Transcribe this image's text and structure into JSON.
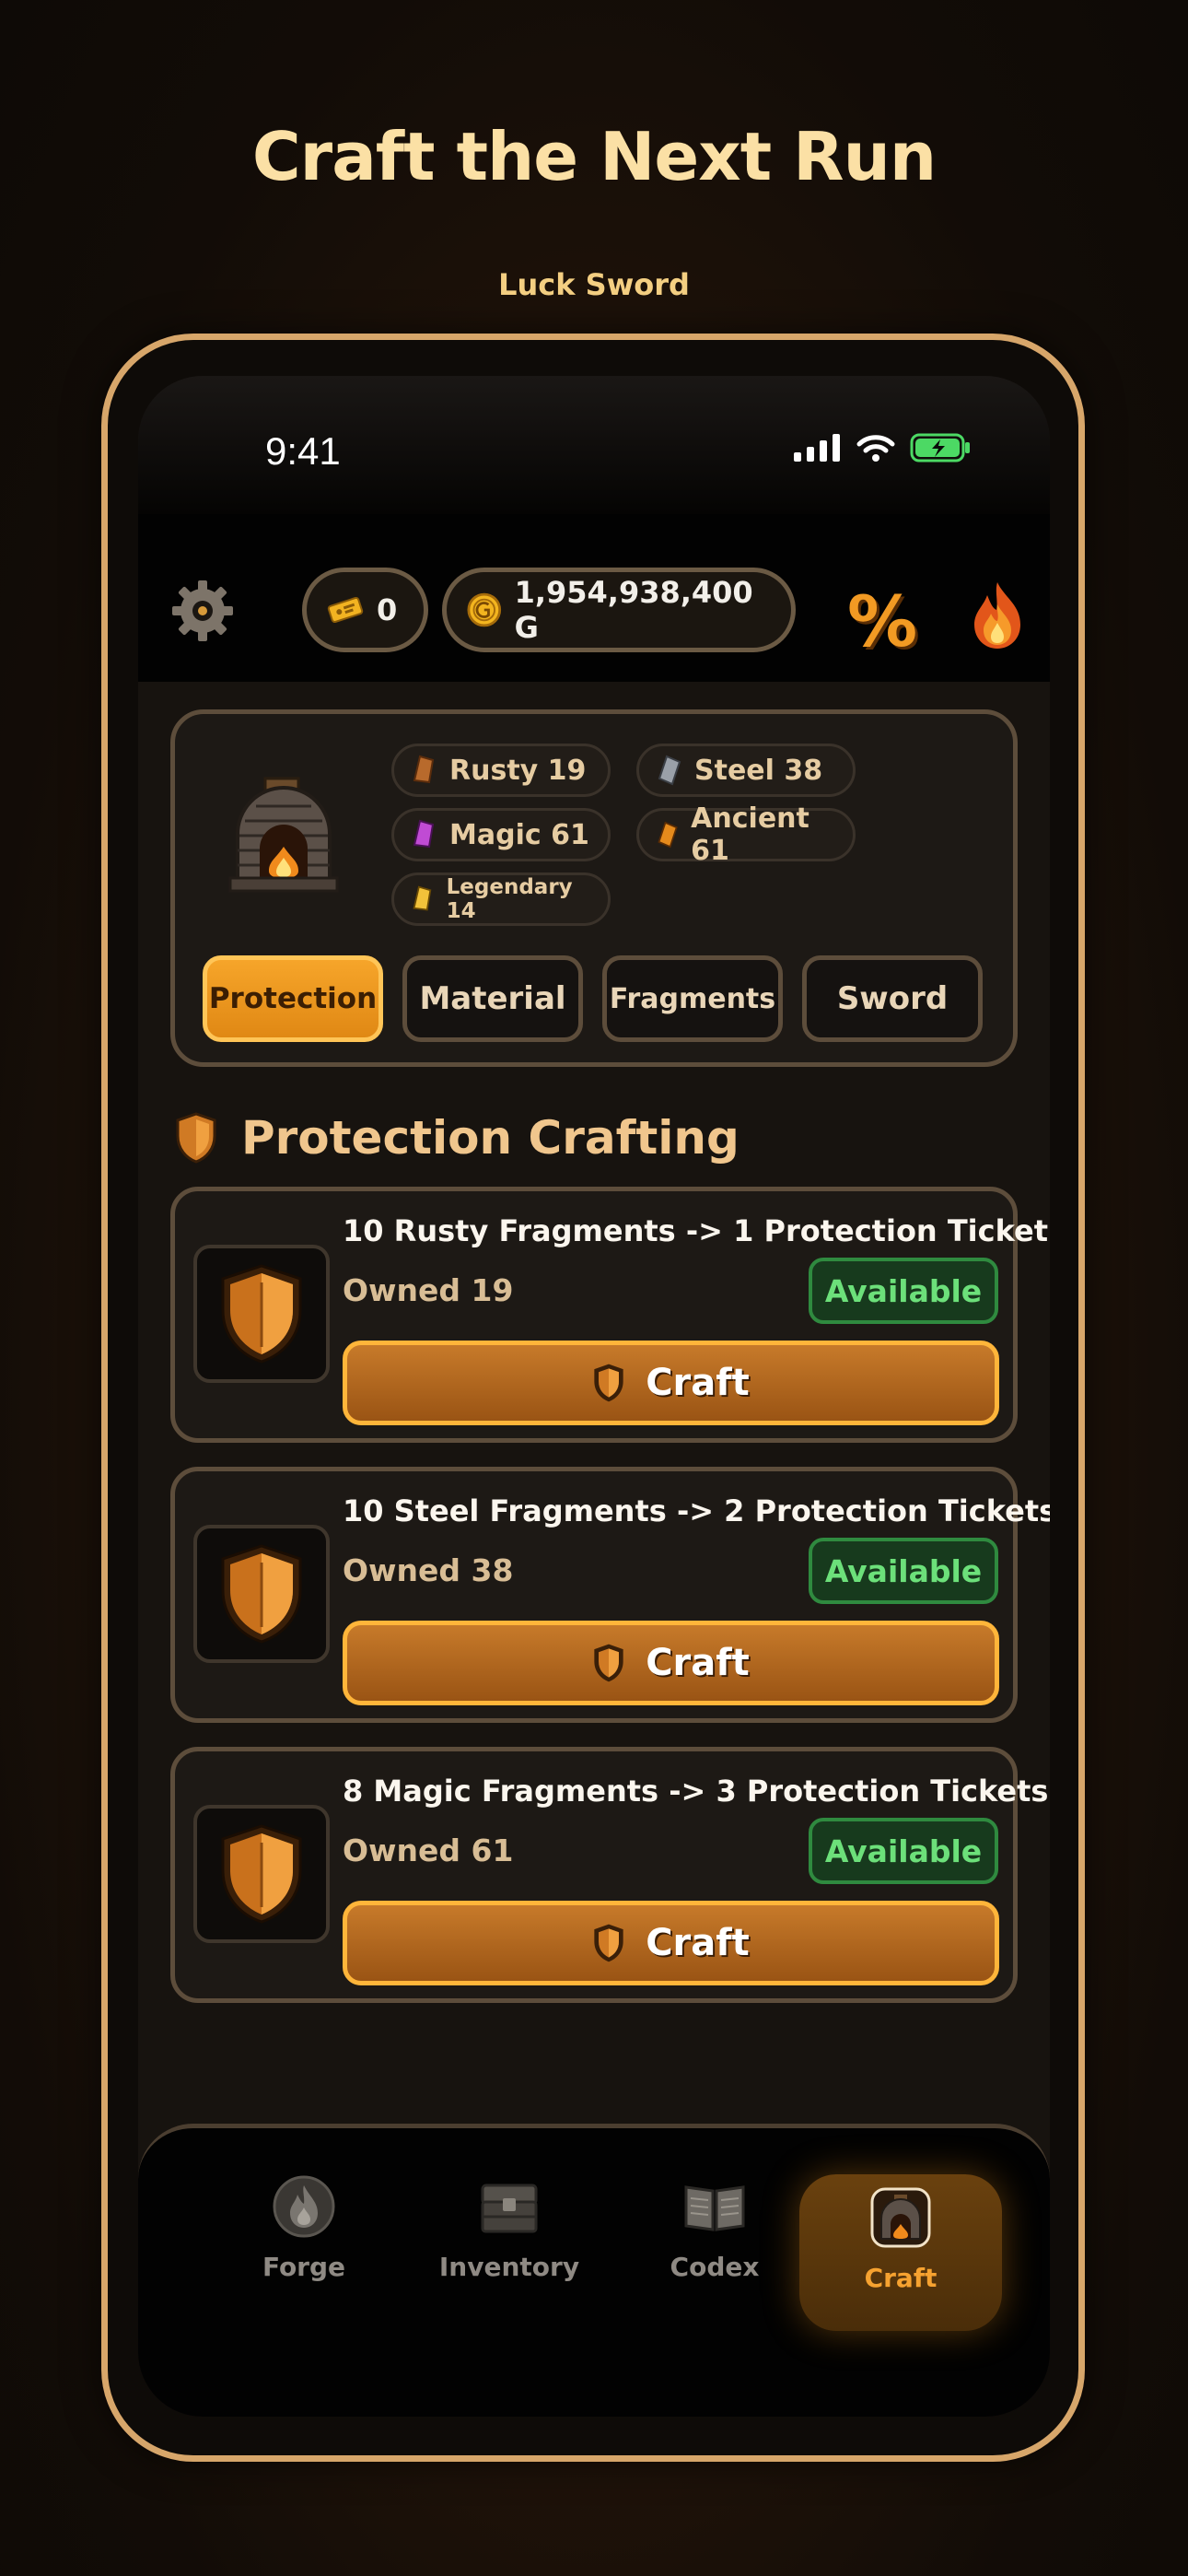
{
  "headline": "Craft the Next Run",
  "subhead": "Luck Sword",
  "status": {
    "time": "9:41"
  },
  "topbar": {
    "tickets": "0",
    "gold": "1,954,938,400 G",
    "settings_icon": "gear-icon",
    "percent_label": "%"
  },
  "materials": [
    {
      "label": "Rusty 19",
      "color": "#b86a2c"
    },
    {
      "label": "Steel 38",
      "color": "#9aa0a8"
    },
    {
      "label": "Magic 61",
      "color": "#c04bd4"
    },
    {
      "label": "Ancient 61",
      "color": "#e58a1c"
    },
    {
      "label": "Legendary 14",
      "color": "#f2c23a"
    }
  ],
  "tabs": [
    {
      "label": "Protection",
      "active": true
    },
    {
      "label": "Material",
      "active": false
    },
    {
      "label": "Fragments",
      "active": false
    },
    {
      "label": "Sword",
      "active": false
    }
  ],
  "section": {
    "title": "Protection Crafting"
  },
  "recipes": [
    {
      "title": "10 Rusty Fragments -> 1 Protection Ticket",
      "owned": "Owned 19",
      "status": "Available",
      "button": "Craft"
    },
    {
      "title": "10 Steel Fragments -> 2 Protection Tickets",
      "owned": "Owned 38",
      "status": "Available",
      "button": "Craft"
    },
    {
      "title": "8 Magic Fragments -> 3 Protection Tickets",
      "owned": "Owned 61",
      "status": "Available",
      "button": "Craft"
    }
  ],
  "nav": [
    {
      "label": "Forge",
      "icon": "forge-icon",
      "active": false
    },
    {
      "label": "Inventory",
      "icon": "chest-icon",
      "active": false
    },
    {
      "label": "Codex",
      "icon": "book-icon",
      "active": false
    },
    {
      "label": "Craft",
      "icon": "furnace-icon",
      "active": true
    }
  ],
  "colors": {
    "accent": "#f29a23",
    "frame": "#d7a66a",
    "available": "#6ce07a"
  }
}
